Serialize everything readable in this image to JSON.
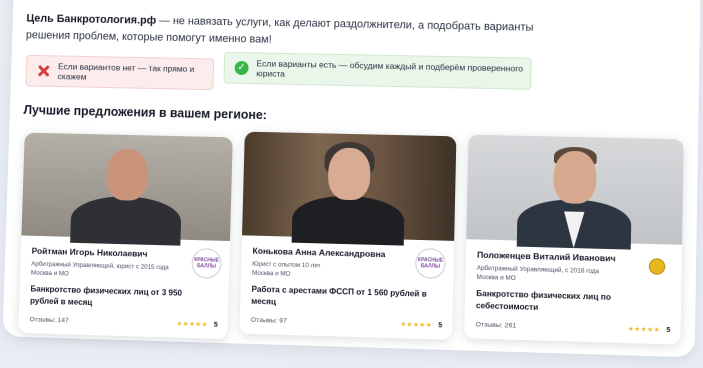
{
  "intro": {
    "brand": "Цель Банкротология.рф",
    "text": " — не навязать услуги, как делают раздолжнители, а подобрать варианты решения проблем, которые помогут именно вам!"
  },
  "notes": {
    "negative": "Если вариантов нет — так прямо и скажем",
    "positive": "Если варианты есть — обсудим каждый и подберём проверенного юриста"
  },
  "section_title": "Лучшие предложения в вашем регионе:",
  "cards": [
    {
      "name": "Ройтман Игорь Николаевич",
      "meta1": "Арбитражный Управляющий, юрист с 2015 года",
      "meta2": "Москва и МО",
      "badge": "КРАСНЫЕ БАЛЛЫ",
      "offer": "Банкротство физических лиц от 3 950 рублей в месяц",
      "reviews": "Отзывы: 147",
      "stars": "★★★★★",
      "rating": "5"
    },
    {
      "name": "Конькова Анна Александровна",
      "meta1": "Юрист с опытом 10 лет",
      "meta2": "Москва и МО",
      "badge": "КРАСНЫЕ БАЛЛЫ",
      "offer": "Работа с арестами ФССП от 1 560 рублей в месяц",
      "reviews": "Отзывы: 97",
      "stars": "★★★★★",
      "rating": "5"
    },
    {
      "name": "Положенцев Виталий Иванович",
      "meta1": "Арбитражный Управляющий, с 2016 года",
      "meta2": "Москва и МО",
      "badge": "",
      "offer": "Банкротство физических лиц по себестоимости",
      "reviews": "Отзывы: 261",
      "stars": "★★★★★",
      "rating": "5"
    }
  ]
}
